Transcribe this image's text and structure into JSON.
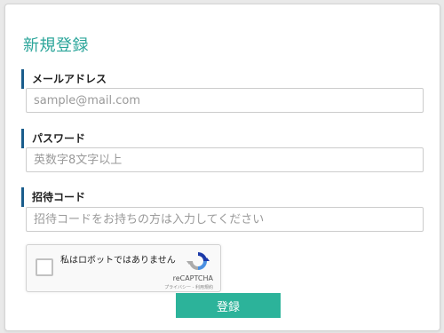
{
  "form": {
    "title": "新規登録",
    "fields": [
      {
        "label": "メールアドレス",
        "placeholder": "sample@mail.com"
      },
      {
        "label": "パスワード",
        "placeholder": "英数字8文字以上"
      },
      {
        "label": "招待コード",
        "placeholder": "招待コードをお持ちの方は入力してください"
      }
    ],
    "recaptcha": {
      "label": "私はロボットではありません",
      "brand": "reCAPTCHA",
      "terms": "プライバシー - 利用規約"
    },
    "submit_label": "登録"
  },
  "colors": {
    "accent": "#2cb39a",
    "title": "#2ba59a",
    "label_bar": "#1a5d8c"
  }
}
